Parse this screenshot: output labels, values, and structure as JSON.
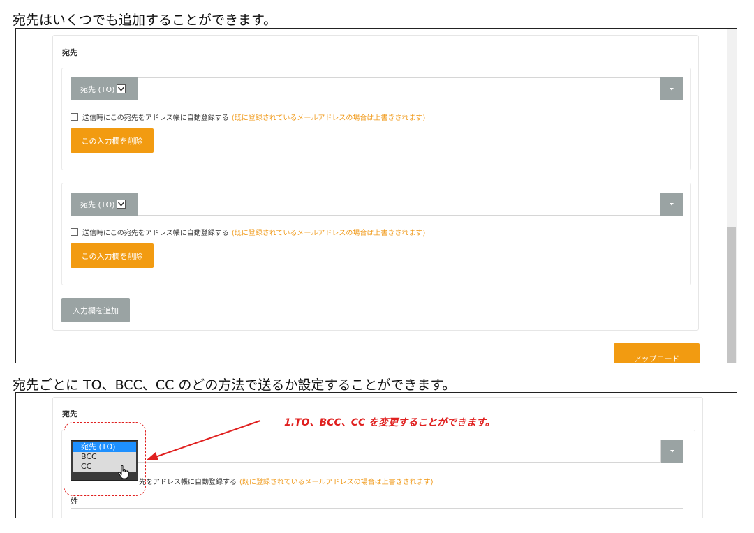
{
  "captions": {
    "top": "宛先はいくつでも追加することができます。",
    "middle": "宛先ごとに TO、BCC、CC のどの方法で送るか設定することができます。"
  },
  "panel1": {
    "section_label": "宛先",
    "rows": [
      {
        "select_label": "宛先 (TO)",
        "input_value": "",
        "checkbox_label": "送信時にこの宛先をアドレス帳に自動登録する",
        "checkbox_note": "(既に登録されているメールアドレスの場合は上書きされます)",
        "delete_label": "この入力欄を削除"
      },
      {
        "select_label": "宛先 (TO)",
        "input_value": "",
        "checkbox_label": "送信時にこの宛先をアドレス帳に自動登録する",
        "checkbox_note": "(既に登録されているメールアドレスの場合は上書きされます)",
        "delete_label": "この入力欄を削除"
      }
    ],
    "add_label": "入力欄を追加",
    "upload_label": "アップロード"
  },
  "panel2": {
    "section_label": "宛先",
    "options": [
      "宛先 (TO)",
      "BCC",
      "CC"
    ],
    "selected_option": "宛先 (TO)",
    "checkbox_label_partial": "先をアドレス帳に自動登録する",
    "checkbox_note": "(既に登録されているメールアドレスの場合は上書きされます)",
    "field_label": "姓",
    "annotation": "1.TO、BCC、CC を変更することができます。"
  },
  "colors": {
    "accent_orange": "#f29b11",
    "gray_button": "#9aa3a3",
    "annotation_red": "#e0201f",
    "selected_blue": "#1e90ff"
  }
}
